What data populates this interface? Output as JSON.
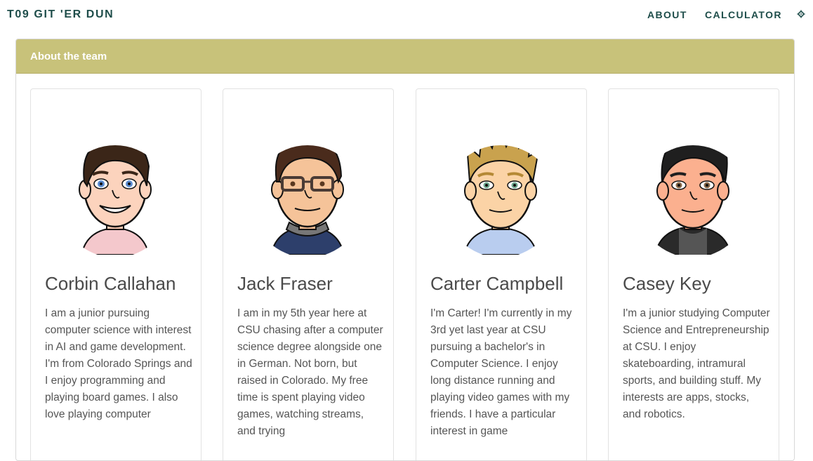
{
  "nav": {
    "brand": "T09 GIT 'ER DUN",
    "about": "ABOUT",
    "calculator": "CALCULATOR",
    "settings_icon": "gear-icon"
  },
  "panel": {
    "title": "About the team"
  },
  "colors": {
    "header_bg": "#c8c27a",
    "nav_text": "#1e4d4a"
  },
  "team": [
    {
      "name": "Corbin Callahan",
      "bio": "I am a junior pursuing computer science with interest in AI and game development. I'm from Colorado Springs and I enjoy programming and playing board games. I also love playing computer",
      "avatar": "avatar-corbin"
    },
    {
      "name": "Jack Fraser",
      "bio": "I am in my 5th year here at CSU chasing after a computer science degree alongside one in German. Not born, but raised in Colorado. My free time is spent playing video games, watching streams, and trying",
      "avatar": "avatar-jack"
    },
    {
      "name": "Carter Campbell",
      "bio": "I'm Carter! I'm currently in my 3rd yet last year at CSU pursuing a bachelor's in Computer Science. I enjoy long distance running and playing video games with my friends. I have a particular interest in game",
      "avatar": "avatar-carter"
    },
    {
      "name": "Casey Key",
      "bio": "I'm a junior studying Computer Science and Entrepreneurship at CSU. I enjoy skateboarding, intramural sports, and building stuff. My interests are apps, stocks, and robotics.",
      "avatar": "avatar-casey"
    }
  ]
}
